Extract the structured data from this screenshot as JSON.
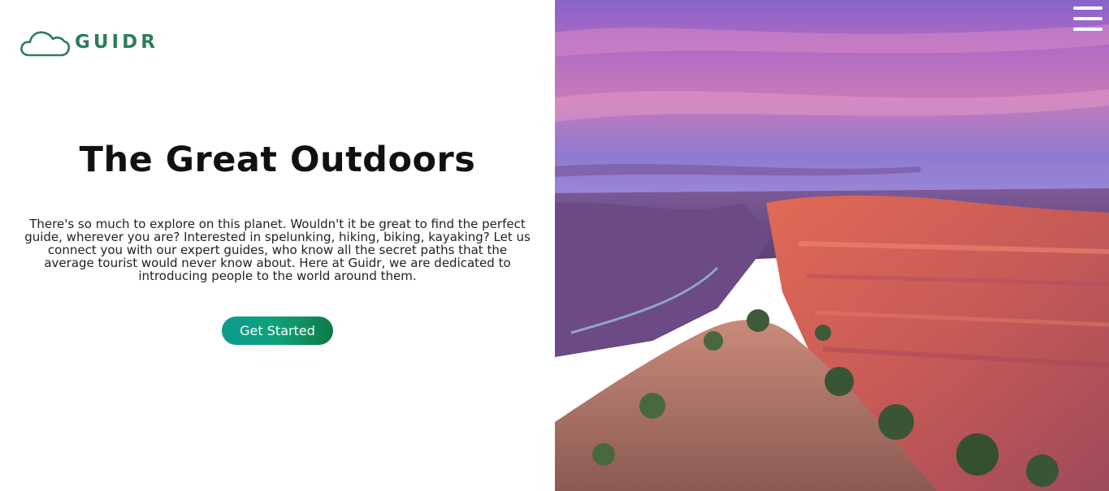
{
  "brand": {
    "name": "GUIDR",
    "logo_icon": "cloud-icon",
    "color": "#2e7d5b"
  },
  "hero": {
    "title": "The Great Outdoors",
    "description": "There's so much to explore on this planet. Wouldn't it be great to find the perfect guide, wherever you are? Interested in spelunking, hiking, biking, kayaking? Let us connect you with our expert guides, who know all the secret paths that the average tourist would never know about. Here at Guidr, we are dedicated to introducing people to the world around them.",
    "cta_label": "Get Started",
    "cta_gradient": [
      "#0b9b8f",
      "#0f7a45"
    ]
  },
  "menu": {
    "icon": "hamburger-menu-icon"
  },
  "image": {
    "subject": "canyon-landscape-photo"
  }
}
